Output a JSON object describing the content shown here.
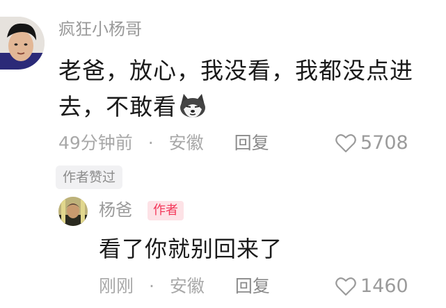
{
  "main_comment": {
    "username": "疯狂小杨哥",
    "text": "老爸，放心，我没看，我都没点进去，不敢看",
    "emoji_icon": "husky-dog-emoji",
    "time": "49分钟前",
    "separator": "·",
    "location": "安徽",
    "reply_label": "回复",
    "like_count": "5708",
    "author_liked_label": "作者赞过"
  },
  "reply_comment": {
    "username": "杨爸",
    "badge": "作者",
    "text": "看了你就别回来了",
    "time": "刚刚",
    "separator": "·",
    "location": "安徽",
    "reply_label": "回复",
    "like_count": "1460"
  },
  "colors": {
    "badge_text": "#f3385a",
    "badge_bg": "#fde2e6",
    "meta_text": "#a8a8a8",
    "body_text": "#1a1a1a"
  }
}
